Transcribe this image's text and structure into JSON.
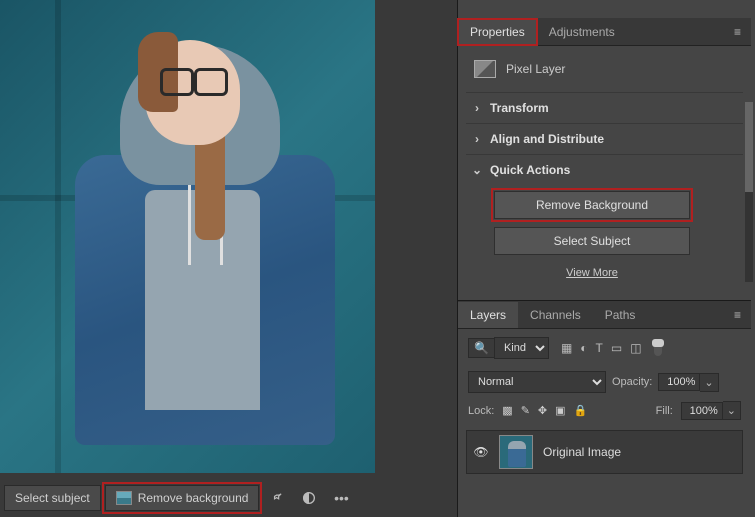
{
  "context_bar": {
    "select_subject": "Select subject",
    "remove_background": "Remove background"
  },
  "properties_panel": {
    "tabs": {
      "properties": "Properties",
      "adjustments": "Adjustments"
    },
    "layer_type": "Pixel Layer",
    "sections": {
      "transform": "Transform",
      "align": "Align and Distribute",
      "quick_actions": "Quick Actions"
    },
    "quick_actions": {
      "remove_background": "Remove Background",
      "select_subject": "Select Subject",
      "view_more": "View More"
    }
  },
  "layers_panel": {
    "tabs": {
      "layers": "Layers",
      "channels": "Channels",
      "paths": "Paths"
    },
    "filter_kind": "Kind",
    "blend_mode": "Normal",
    "opacity_label": "Opacity:",
    "opacity_value": "100%",
    "lock_label": "Lock:",
    "fill_label": "Fill:",
    "fill_value": "100%",
    "layers": [
      {
        "name": "Original Image"
      }
    ]
  }
}
